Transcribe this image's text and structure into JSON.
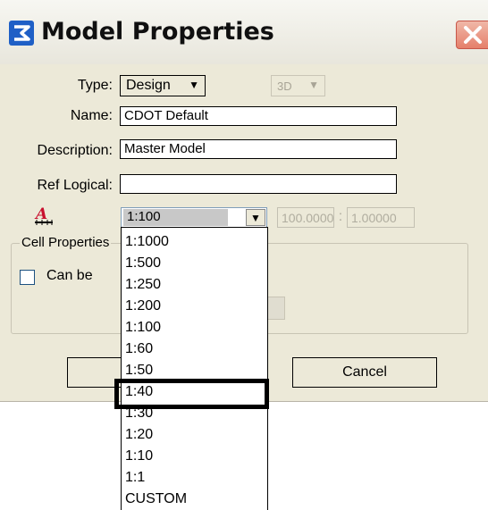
{
  "window": {
    "title": "Model Properties"
  },
  "form": {
    "type_label": "Type:",
    "type_value": "Design",
    "dimension_value": "3D",
    "name_label": "Name:",
    "name_value": "CDOT Default",
    "description_label": "Description:",
    "description_value": "Master Model",
    "ref_logical_label": "Ref Logical:",
    "ref_logical_value": "",
    "annotation_scale_value": "1:100",
    "scale_ratio_left": "100.0000",
    "scale_ratio_sep": ":",
    "scale_ratio_right": "1.00000"
  },
  "cell_properties": {
    "legend": "Cell Properties",
    "checkbox_label": "Can be",
    "checkbox_checked": false
  },
  "buttons": {
    "ok": "",
    "cancel": "Cancel"
  },
  "scale_dropdown": {
    "options": [
      "1:1000",
      "1:500",
      "1:250",
      "1:200",
      "1:100",
      "1:60",
      "1:50",
      "1:40",
      "1:30",
      "1:20",
      "1:10",
      "1:1",
      "CUSTOM"
    ],
    "highlighted": "1:40"
  },
  "colors": {
    "dialog_bg": "#ece9d8",
    "close_red": "#e57f6a",
    "annotation_icon": "#c8102e"
  }
}
